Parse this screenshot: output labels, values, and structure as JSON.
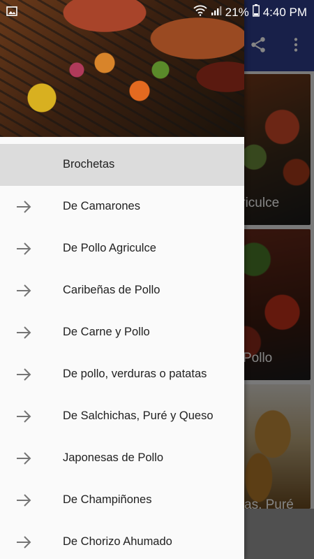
{
  "status_bar": {
    "battery_percent": "21%",
    "time": "4:40 PM"
  },
  "background": {
    "toolbar_color": "#2f3e8c",
    "cards": [
      {
        "label": "Agriculce"
      },
      {
        "label": "Pollo"
      },
      {
        "label": "as, Puré"
      }
    ]
  },
  "drawer": {
    "menu": [
      {
        "label": "Brochetas",
        "selected": true
      },
      {
        "label": "De Camarones"
      },
      {
        "label": "De Pollo Agriculce"
      },
      {
        "label": "Caribeñas de Pollo"
      },
      {
        "label": "De Carne y Pollo"
      },
      {
        "label": "De pollo, verduras o patatas"
      },
      {
        "label": "De Salchichas, Puré y Queso"
      },
      {
        "label": "Japonesas de Pollo"
      },
      {
        "label": "De Champiñones"
      },
      {
        "label": "De Chorizo Ahumado"
      }
    ]
  },
  "icons": {
    "share": "share-icon",
    "overflow": "more-vert-icon",
    "menu_arrow": "arrow-right-icon"
  }
}
